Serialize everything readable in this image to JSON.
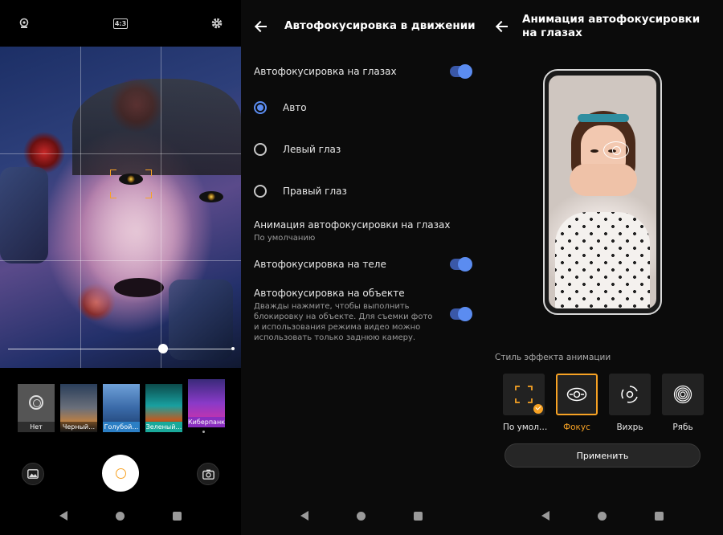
{
  "camera": {
    "ratio_label": "4:3",
    "filters": [
      "Нет",
      "Черный…",
      "Голубой…",
      "Зеленый…",
      "Киберпанк"
    ],
    "zoom_level": 0.69
  },
  "settings": {
    "title": "Автофокусировка в движении",
    "eye_af_label": "Автофокусировка на глазах",
    "eye_af_on": true,
    "options": [
      "Авто",
      "Левый глаз",
      "Правый глаз"
    ],
    "selected_option": "Авто",
    "eye_anim_label": "Анимация автофокусировки на глазах",
    "eye_anim_value": "По умолчанию",
    "body_af_label": "Автофокусировка на теле",
    "body_af_on": true,
    "object_af_label": "Автофокусировка на объекте",
    "object_af_desc": "Дважды нажмите, чтобы выполнить блокировку на объекте. Для съемки фото и использования режима видео можно использовать только заднюю камеру.",
    "object_af_on": true
  },
  "animation": {
    "title": "Анимация автофокусировки на глазах",
    "style_label": "Стиль эффекта анимации",
    "styles": [
      "По умол…",
      "Фокус",
      "Вихрь",
      "Рябь"
    ],
    "selected_style": "Фокус",
    "apply_label": "Применить"
  },
  "colors": {
    "accent_orange": "#f7a224",
    "toggle_blue": "#5b8cf0"
  },
  "icons": {
    "camera_top": [
      "flash-auto-icon",
      "aspect-ratio-icon",
      "gear-icon"
    ],
    "camera_bottom": [
      "gallery-icon",
      "shutter-button",
      "switch-camera-icon"
    ],
    "nav": [
      "back-triangle-icon",
      "home-circle-icon",
      "recents-square-icon"
    ]
  }
}
